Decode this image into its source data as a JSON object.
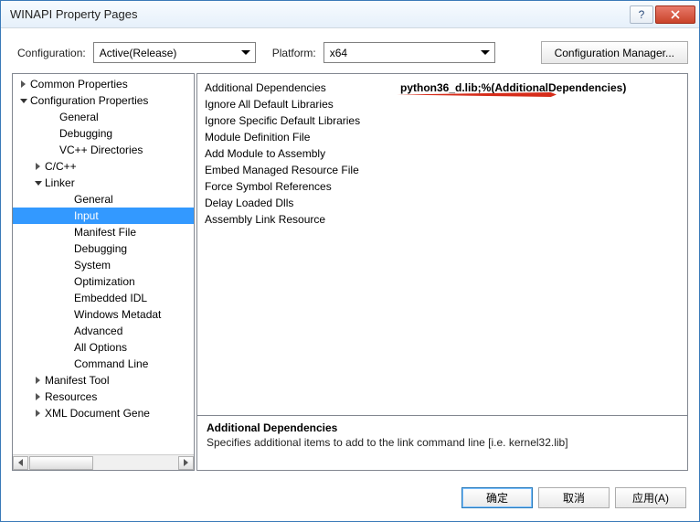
{
  "title": "WINAPI Property Pages",
  "config": {
    "configuration_label": "Configuration:",
    "configuration_value": "Active(Release)",
    "platform_label": "Platform:",
    "platform_value": "x64",
    "manager_button": "Configuration Manager..."
  },
  "tree": {
    "items": [
      {
        "label": "Common Properties",
        "indent": 0,
        "exp": "r"
      },
      {
        "label": "Configuration Properties",
        "indent": 0,
        "exp": "d"
      },
      {
        "label": "General",
        "indent": 2,
        "exp": ""
      },
      {
        "label": "Debugging",
        "indent": 2,
        "exp": ""
      },
      {
        "label": "VC++ Directories",
        "indent": 2,
        "exp": ""
      },
      {
        "label": "C/C++",
        "indent": 1,
        "exp": "r"
      },
      {
        "label": "Linker",
        "indent": 1,
        "exp": "d"
      },
      {
        "label": "General",
        "indent": 3,
        "exp": ""
      },
      {
        "label": "Input",
        "indent": 3,
        "exp": "",
        "sel": true
      },
      {
        "label": "Manifest File",
        "indent": 3,
        "exp": ""
      },
      {
        "label": "Debugging",
        "indent": 3,
        "exp": ""
      },
      {
        "label": "System",
        "indent": 3,
        "exp": ""
      },
      {
        "label": "Optimization",
        "indent": 3,
        "exp": ""
      },
      {
        "label": "Embedded IDL",
        "indent": 3,
        "exp": ""
      },
      {
        "label": "Windows Metadat",
        "indent": 3,
        "exp": ""
      },
      {
        "label": "Advanced",
        "indent": 3,
        "exp": ""
      },
      {
        "label": "All Options",
        "indent": 3,
        "exp": ""
      },
      {
        "label": "Command Line",
        "indent": 3,
        "exp": ""
      },
      {
        "label": "Manifest Tool",
        "indent": 1,
        "exp": "r"
      },
      {
        "label": "Resources",
        "indent": 1,
        "exp": "r"
      },
      {
        "label": "XML Document Gene",
        "indent": 1,
        "exp": "r"
      }
    ]
  },
  "props": [
    {
      "label": "Additional Dependencies",
      "value": "python36_d.lib;%(AdditionalDependencies)",
      "arrow": true
    },
    {
      "label": "Ignore All Default Libraries",
      "value": ""
    },
    {
      "label": "Ignore Specific Default Libraries",
      "value": ""
    },
    {
      "label": "Module Definition File",
      "value": ""
    },
    {
      "label": "Add Module to Assembly",
      "value": ""
    },
    {
      "label": "Embed Managed Resource File",
      "value": ""
    },
    {
      "label": "Force Symbol References",
      "value": ""
    },
    {
      "label": "Delay Loaded Dlls",
      "value": ""
    },
    {
      "label": "Assembly Link Resource",
      "value": ""
    }
  ],
  "desc": {
    "title": "Additional Dependencies",
    "text": "Specifies additional items to add to the link command line [i.e. kernel32.lib]"
  },
  "buttons": {
    "ok": "确定",
    "cancel": "取消",
    "apply": "应用(A)"
  },
  "titlebar": {
    "help": "?"
  }
}
